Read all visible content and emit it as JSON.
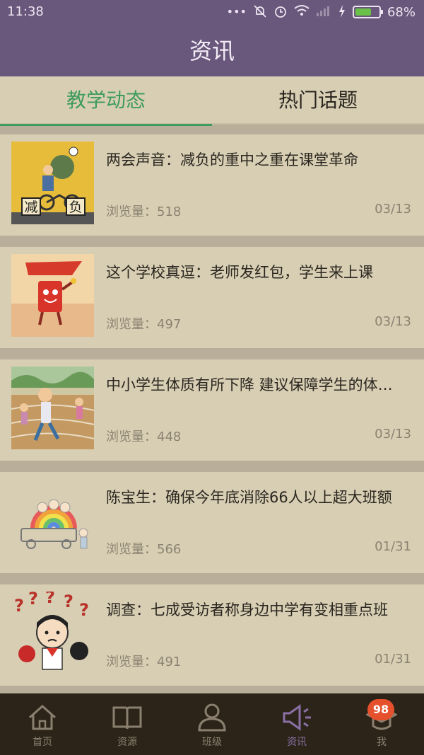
{
  "status_bar": {
    "time": "11:38",
    "battery": "68%",
    "battery_level": 0.68,
    "icons": [
      "more-dots-icon",
      "mute-icon",
      "alarm-icon",
      "wifi-icon",
      "signal-icon",
      "charging-icon",
      "battery-icon"
    ]
  },
  "header": {
    "title": "资讯"
  },
  "tabs": [
    {
      "label": "教学动态",
      "active": true
    },
    {
      "label": "热门话题",
      "active": false
    }
  ],
  "articles": [
    {
      "title": "两会声音：减负的重中之重在课堂革命",
      "views": "浏览量：518",
      "date": "03/13",
      "thumb": "减 负"
    },
    {
      "title": "这个学校真逗：老师发红包，学生来上课",
      "views": "浏览量：497",
      "date": "03/13",
      "thumb": ""
    },
    {
      "title": "中小学生体质有所下降 建议保障学生的体…",
      "views": "浏览量：448",
      "date": "03/13",
      "thumb": ""
    },
    {
      "title": "陈宝生：确保今年底消除66人以上超大班额",
      "views": "浏览量：566",
      "date": "01/31",
      "thumb": ""
    },
    {
      "title": "调查：七成受访者称身边中学有变相重点班",
      "views": "浏览量：491",
      "date": "01/31",
      "thumb": ""
    }
  ],
  "thumb_text": {
    "a1_left": "减",
    "a1_right": "负"
  },
  "bottom_nav": [
    {
      "label": "首页",
      "icon": "home-icon",
      "active": false
    },
    {
      "label": "资源",
      "icon": "book-icon",
      "active": false
    },
    {
      "label": "班级",
      "icon": "group-icon",
      "active": false
    },
    {
      "label": "资讯",
      "icon": "megaphone-icon",
      "active": true
    },
    {
      "label": "我",
      "icon": "graduation-cap-icon",
      "active": false
    }
  ],
  "badge": "98",
  "colors": {
    "accent": "#3f9c5f",
    "header_bg": "#6a577c",
    "nav_bg": "#2c2418",
    "badge": "#e4512c"
  }
}
